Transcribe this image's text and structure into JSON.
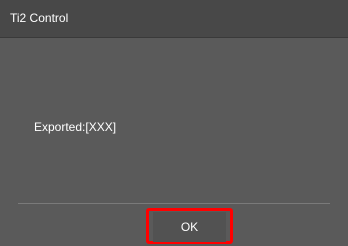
{
  "window": {
    "title": "Ti2 Control"
  },
  "dialog": {
    "message": "Exported:[XXX]",
    "ok_label": "OK"
  },
  "colors": {
    "background": "#5a5a5a",
    "titlebar": "#484848",
    "text": "#ffffff",
    "highlight": "#ff0000"
  }
}
